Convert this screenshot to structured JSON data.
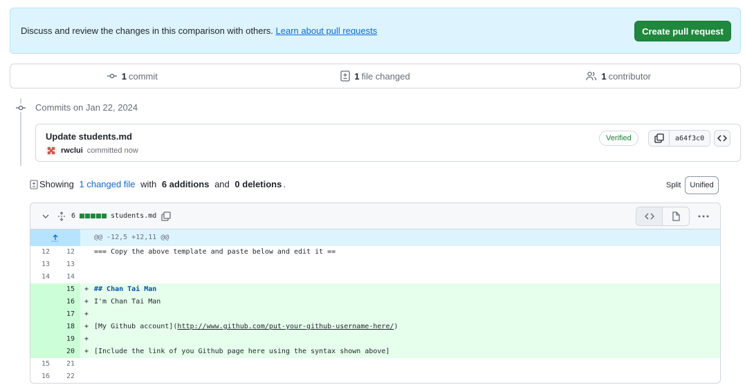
{
  "banner": {
    "text": "Discuss and review the changes in this comparison with others.",
    "link": "Learn about pull requests",
    "button": "Create pull request"
  },
  "stats": {
    "commits_count": "1",
    "commits_label": "commit",
    "files_count": "1",
    "files_label": "file changed",
    "contributors_count": "1",
    "contributors_label": "contributor"
  },
  "timeline": {
    "heading": "Commits on Jan 22, 2024",
    "commit": {
      "title": "Update students.md",
      "author": "rwclui",
      "action": "committed now",
      "verified": "Verified",
      "sha": "a64f3c0"
    }
  },
  "summary": {
    "prefix": "Showing",
    "changed": "1 changed file",
    "with": "with",
    "additions": "6 additions",
    "and": "and",
    "deletions": "0 deletions",
    "end": "."
  },
  "view": {
    "split": "Split",
    "unified": "Unified"
  },
  "file": {
    "count": "6",
    "name": "students.md",
    "hunk": "@@ -12,5 +12,11 @@"
  },
  "lines": [
    {
      "type": "ctx",
      "old": "12",
      "new": "12",
      "text": "=== Copy the above template and paste below and edit it =="
    },
    {
      "type": "ctx",
      "old": "13",
      "new": "13",
      "text": ""
    },
    {
      "type": "ctx",
      "old": "14",
      "new": "14",
      "text": ""
    },
    {
      "type": "add",
      "old": "",
      "new": "15",
      "text": "## Chan Tai Man"
    },
    {
      "type": "add",
      "old": "",
      "new": "16",
      "text": "I'm Chan Tai Man"
    },
    {
      "type": "add",
      "old": "",
      "new": "17",
      "text": ""
    },
    {
      "type": "add",
      "old": "",
      "new": "18",
      "text": "[My Github account](http://www.github.com/put-your-github-username-here/)"
    },
    {
      "type": "add",
      "old": "",
      "new": "19",
      "text": ""
    },
    {
      "type": "add",
      "old": "",
      "new": "20",
      "text": "[Include the link of you Github page here using the syntax shown above]"
    },
    {
      "type": "ctx",
      "old": "15",
      "new": "21",
      "text": ""
    },
    {
      "type": "ctx",
      "old": "16",
      "new": "22",
      "text": ""
    }
  ],
  "colors": {
    "accent": "#0969da",
    "success": "#1f883d",
    "addition_bg": "#e6ffec",
    "hunk_bg": "#ddf4ff"
  }
}
